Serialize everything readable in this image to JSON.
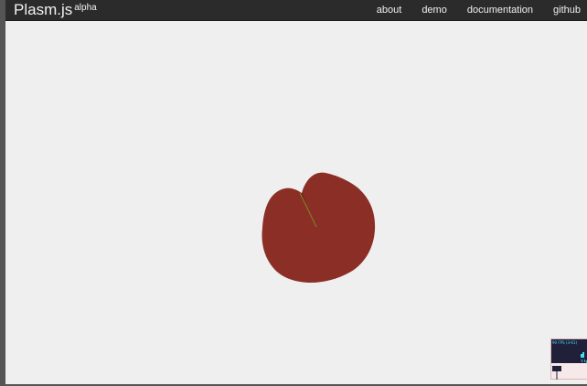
{
  "navbar": {
    "brand": "Plasm.js",
    "brand_suffix": "alpha",
    "links": [
      {
        "label": "about"
      },
      {
        "label": "demo"
      },
      {
        "label": "documentation"
      },
      {
        "label": "github"
      }
    ]
  },
  "scene": {
    "shape_color": "#8b2e26",
    "stroke_color": "#7a8a22"
  },
  "stats": {
    "fps_text": "90 FPS (3-61)",
    "panel_color": "#20203a",
    "graph_color": "#40e0f0"
  }
}
